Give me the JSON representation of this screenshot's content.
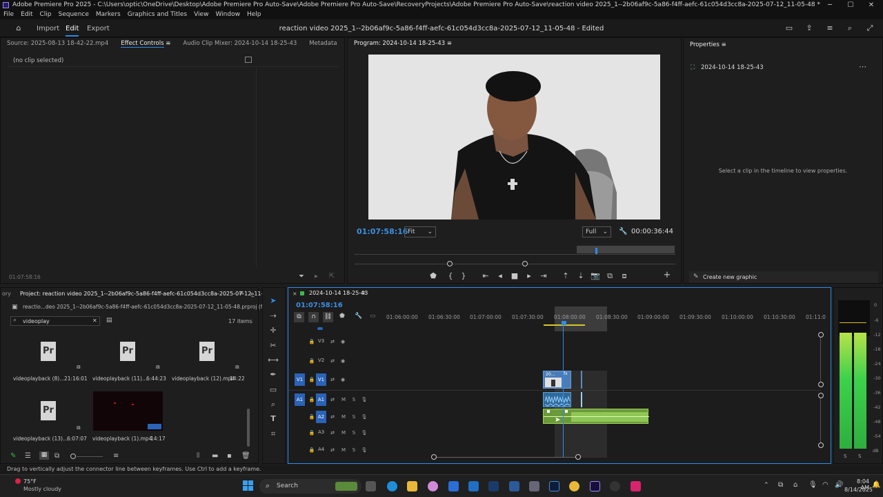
{
  "window": {
    "title": "Adobe Premiere Pro 2025 - C:\\Users\\optic\\OneDrive\\Desktop\\Adobe Premiere Pro Auto-Save\\Adobe Premiere Pro Auto-Save\\RecoveryProjects\\Adobe Premiere Pro Auto-Save\\reaction video 2025_1--2b06af9c-5a86-f4ff-aefc-61c054d3cc8a-2025-07-12_11-05-48 *",
    "minimize": "─",
    "maximize": "☐",
    "close": "✕"
  },
  "menu": [
    "File",
    "Edit",
    "Clip",
    "Sequence",
    "Markers",
    "Graphics and Titles",
    "View",
    "Window",
    "Help"
  ],
  "header": {
    "nav": [
      "Import",
      "Edit",
      "Export"
    ],
    "active_nav": "Edit",
    "doc_title": "reaction video 2025_1--2b06af9c-5a86-f4ff-aefc-61c054d3cc8a-2025-07-12_11-05-48 - Edited"
  },
  "source_panel": {
    "tabs": [
      "Source: 2025-08-13 18-42-22.mp4",
      "Effect Controls",
      "Audio Clip Mixer: 2024-10-14 18-25-43",
      "Metadata"
    ],
    "empty_text": "(no clip selected)",
    "timecode": "01:07:58:16"
  },
  "program_panel": {
    "tab": "Program: 2024-10-14 18-25-43",
    "timecode": "01:07:58:16",
    "fit_label": "Fit",
    "quality_label": "Full",
    "duration": "00:00:36:44"
  },
  "properties_panel": {
    "tab": "Properties",
    "sequence_name": "2024-10-14 18-25-43",
    "hint": "Select a clip in the timeline to view properties.",
    "create_graphic": "Create new graphic"
  },
  "project_panel": {
    "left_tab_fragment": "ory",
    "tab": "Project: reaction video 2025_1--2b06af9c-5a86-f4ff-aefc-61c054d3cc8a-2025-07-12_11-05-48",
    "file_name": "reactio...deo 2025_1--2b06af9c-5a86-f4ff-aefc-61c054d3cc8a-2025-07-12_11-05-48.prproj (filtered)",
    "search_value": "videoplay",
    "item_count": "17 items",
    "items": [
      {
        "name": "videoplayback (8)...",
        "duration": "21:16:01"
      },
      {
        "name": "videoplayback (11)...",
        "duration": "6:44:23"
      },
      {
        "name": "videoplayback (12).mp4",
        "duration": "14:22"
      },
      {
        "name": "videoplayback (13)...",
        "duration": "6:07:07"
      },
      {
        "name": "videoplayback (1).mp4",
        "duration": "14:17"
      }
    ]
  },
  "timeline": {
    "tab": "2024-10-14 18-25-43",
    "timecode": "01:07:58:16",
    "ruler": [
      "01:06:00:00",
      "01:06:30:00",
      "01:07:00:00",
      "01:07:30:00",
      "01:08:00:00",
      "01:08:30:00",
      "01:09:00:00",
      "01:09:30:00",
      "01:10:00:00",
      "01:10:30:00",
      "01:11:0"
    ],
    "video_tracks": [
      "V3",
      "V2",
      "V1"
    ],
    "audio_tracks": [
      "A1",
      "A2",
      "A3",
      "A4"
    ],
    "source_patch_video": "V1",
    "source_patch_audio": "A1",
    "clip_label": "20..."
  },
  "meter": {
    "scale": [
      "0",
      "-6",
      "-12",
      "-18",
      "-24",
      "-30",
      "-36",
      "-42",
      "-48",
      "-54",
      "dB"
    ],
    "solo": [
      "S",
      "S"
    ]
  },
  "status_bar": "Drag to vertically adjust the connector line between keyframes. Use Ctrl to add a keyframe.",
  "taskbar": {
    "weather_temp": "75°F",
    "weather_desc": "Mostly cloudy",
    "search": "Search",
    "time": "8:04 AM",
    "date": "8/14/2025"
  }
}
